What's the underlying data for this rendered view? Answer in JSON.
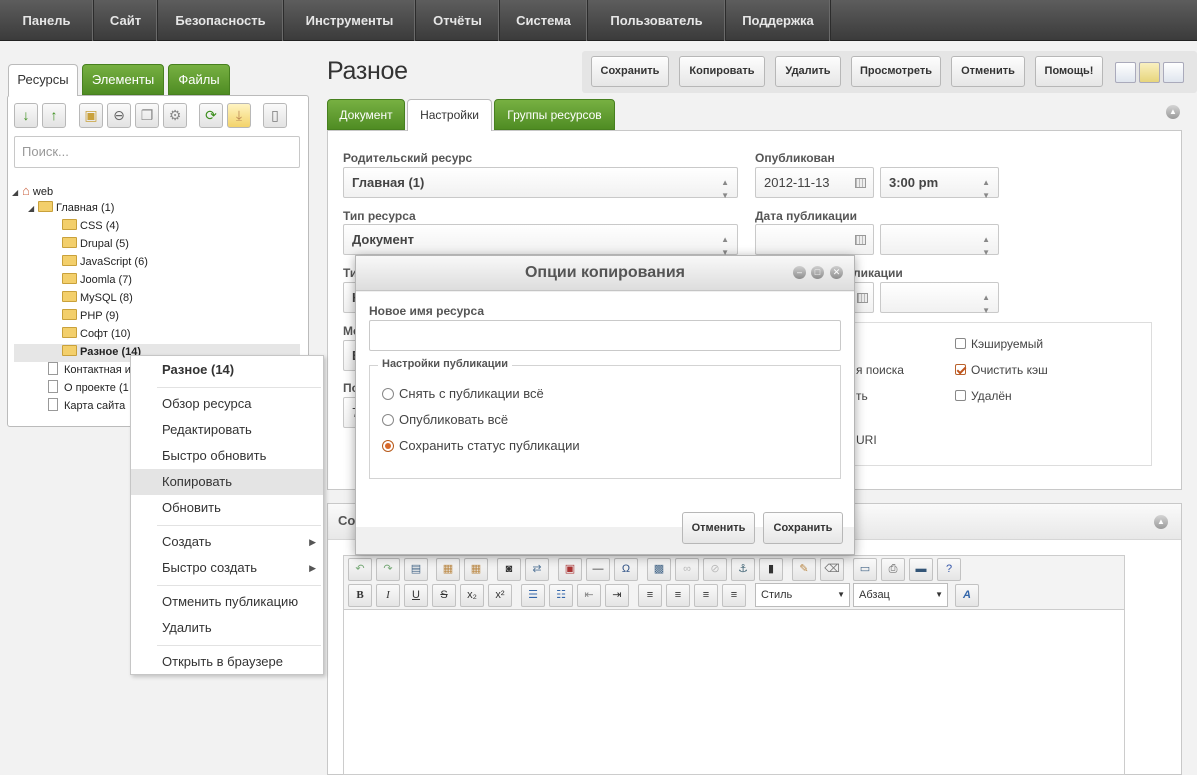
{
  "topnav": [
    "Панель",
    "Сайт",
    "Безопасность",
    "Инструменты",
    "Отчёты",
    "Система",
    "Пользователь",
    "Поддержка"
  ],
  "left": {
    "tabs": [
      "Ресурсы",
      "Элементы",
      "Файлы"
    ],
    "search_placeholder": "Поиск...",
    "tree": {
      "root": "web",
      "home": "Главная",
      "home_count": "(1)",
      "folders": [
        {
          "name": "CSS",
          "count": "(4)"
        },
        {
          "name": "Drupal",
          "count": "(5)"
        },
        {
          "name": "JavaScript",
          "count": "(6)"
        },
        {
          "name": "Joomla",
          "count": "(7)"
        },
        {
          "name": "MySQL",
          "count": "(8)"
        },
        {
          "name": "PHP",
          "count": "(9)"
        },
        {
          "name": "Софт",
          "count": "(10)"
        },
        {
          "name": "Разное",
          "count": "(14)"
        }
      ],
      "docs": [
        "Контактная и",
        "О проекте (1",
        "Карта сайта"
      ]
    }
  },
  "context_menu": {
    "header": "Разное (14)",
    "items": [
      "Обзор ресурса",
      "Редактировать",
      "Быстро обновить",
      "Копировать",
      "Обновить",
      "Создать",
      "Быстро создать",
      "Отменить публикацию",
      "Удалить",
      "Открыть в браузере"
    ]
  },
  "page": {
    "title": "Разное",
    "actions": [
      "Сохранить",
      "Копировать",
      "Удалить",
      "Просмотреть",
      "Отменить",
      "Помощь!"
    ],
    "tabs": [
      "Документ",
      "Настройки",
      "Группы ресурсов"
    ]
  },
  "form": {
    "parent_label": "Родительский ресурс",
    "parent_value": "Главная (1)",
    "type_label": "Тип ресурса",
    "type_value": "Документ",
    "ti_label": "Ти",
    "ti_value": "К",
    "me_label": "Ме",
    "me_value": "E",
    "po_label": "По",
    "po_value": "7",
    "published_label": "Опубликован",
    "published_date": "2012-11-13",
    "published_time": "3:00 pm",
    "pubdate_label": "Дата публикации",
    "unpub_label": "ликации",
    "checks": [
      {
        "label": "Кэшируемый",
        "checked": false
      },
      {
        "label": "Очистить кэш",
        "checked": true
      },
      {
        "label": "Удалён",
        "checked": false
      }
    ],
    "partial_search": "я поиска",
    "partial_t": "ть",
    "partial_uri": "URI"
  },
  "content": {
    "section_label": "Со",
    "style_select": "Стиль",
    "format_select": "Абзац"
  },
  "modal": {
    "title": "Опции копирования",
    "name_label": "Новое имя ресурса",
    "name_value": "",
    "fieldset_legend": "Настройки публикации",
    "radios": [
      "Снять с публикации всё",
      "Опубликовать всё",
      "Сохранить статус публикации"
    ],
    "selected_radio": 2,
    "cancel": "Отменить",
    "save": "Сохранить"
  }
}
